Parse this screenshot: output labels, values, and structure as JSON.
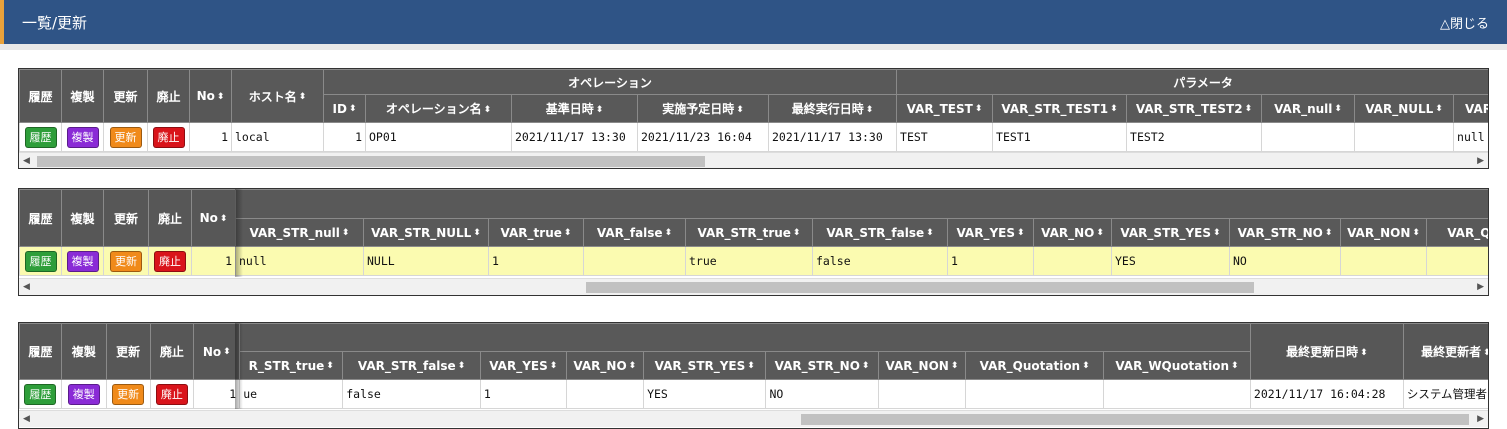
{
  "header": {
    "title": "一覧/更新",
    "close_label": "△閉じる"
  },
  "buttons": {
    "history": "履歴",
    "copy": "複製",
    "update": "更新",
    "discard": "廃止"
  },
  "colors": {
    "header_bg": "#2f5486",
    "accent": "#e9a23b",
    "history": "#2e9e3a",
    "copy": "#8a2bd6",
    "update": "#f08a1a",
    "discard": "#d9141b",
    "highlight": "#fbfbb0"
  },
  "panel1": {
    "fixed_headers": [
      "履歴",
      "複製",
      "更新",
      "廃止",
      "No"
    ],
    "host_header": "ホスト名",
    "group_operation": "オペレーション",
    "group_parameter": "パラメータ",
    "columns": [
      "ID",
      "オペレーション名",
      "基準日時",
      "実施予定日時",
      "最終実行日時",
      "VAR_TEST",
      "VAR_STR_TEST1",
      "VAR_STR_TEST2",
      "VAR_null",
      "VAR_NULL",
      "VAR_"
    ],
    "row": {
      "no": "1",
      "host": "local",
      "cells": [
        "1",
        "OP01",
        "2021/11/17 13:30",
        "2021/11/23 16:04",
        "2021/11/17 13:30",
        "TEST",
        "TEST1",
        "TEST2",
        "",
        "",
        "null"
      ]
    }
  },
  "panel2": {
    "fixed_headers": [
      "履歴",
      "複製",
      "更新",
      "廃止",
      "No"
    ],
    "columns": [
      "VAR_STR_null",
      "VAR_STR_NULL",
      "VAR_true",
      "VAR_false",
      "VAR_STR_true",
      "VAR_STR_false",
      "VAR_YES",
      "VAR_NO",
      "VAR_STR_YES",
      "VAR_STR_NO",
      "VAR_NON",
      "VAR_Qu"
    ],
    "row": {
      "no": "1",
      "cells": [
        "null",
        "NULL",
        "1",
        "",
        "true",
        "false",
        "1",
        "",
        "YES",
        "NO",
        "",
        ""
      ]
    }
  },
  "panel3": {
    "fixed_headers": [
      "履歴",
      "複製",
      "更新",
      "廃止",
      "No"
    ],
    "columns": [
      "R_STR_true",
      "VAR_STR_false",
      "VAR_YES",
      "VAR_NO",
      "VAR_STR_YES",
      "VAR_STR_NO",
      "VAR_NON",
      "VAR_Quotation",
      "VAR_WQuotation"
    ],
    "right_headers": [
      "最終更新日時",
      "最終更新者"
    ],
    "row": {
      "no": "1",
      "cells": [
        "ue",
        "false",
        "1",
        "",
        "YES",
        "NO",
        "",
        "",
        ""
      ],
      "right_cells": [
        "2021/11/17 16:04:28",
        "システム管理者"
      ]
    }
  }
}
